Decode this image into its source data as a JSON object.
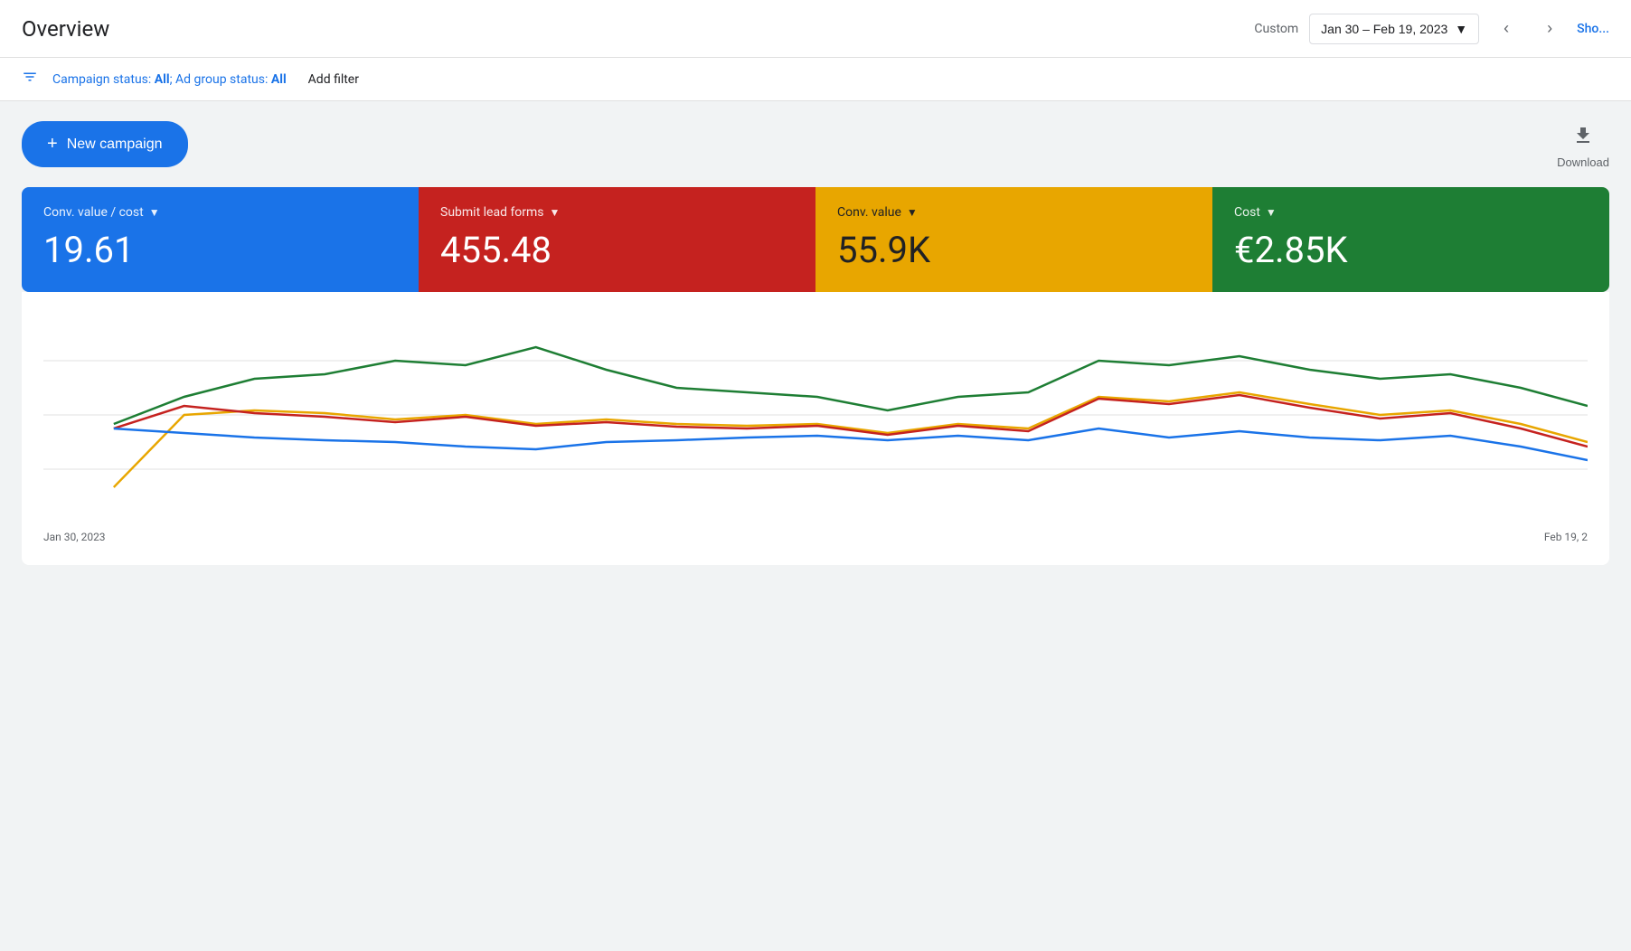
{
  "header": {
    "title": "Overview",
    "custom_label": "Custom",
    "date_range": "Jan 30 – Feb 19, 2023",
    "show_label": "Sho..."
  },
  "filter_bar": {
    "filter_text": "Campaign status: ",
    "filter_all1": "All",
    "separator": "; Ad group status: ",
    "filter_all2": "All",
    "add_filter": "Add filter"
  },
  "actions": {
    "new_campaign_label": "New campaign",
    "download_label": "Download"
  },
  "metrics": [
    {
      "id": "conv-value-cost",
      "label": "Conv. value / cost",
      "value": "19.61",
      "color": "blue",
      "dark_text": false
    },
    {
      "id": "submit-lead-forms",
      "label": "Submit lead forms",
      "value": "455.48",
      "color": "red",
      "dark_text": false
    },
    {
      "id": "conv-value",
      "label": "Conv. value",
      "value": "55.9K",
      "color": "yellow",
      "dark_text": true
    },
    {
      "id": "cost",
      "label": "Cost",
      "value": "€2.85K",
      "color": "green",
      "dark_text": false
    }
  ],
  "chart": {
    "start_date": "Jan 30, 2023",
    "end_date": "Feb 19, 2",
    "colors": {
      "blue": "#1a73e8",
      "red": "#c5221f",
      "yellow": "#e8a600",
      "green": "#1e7e34"
    }
  }
}
